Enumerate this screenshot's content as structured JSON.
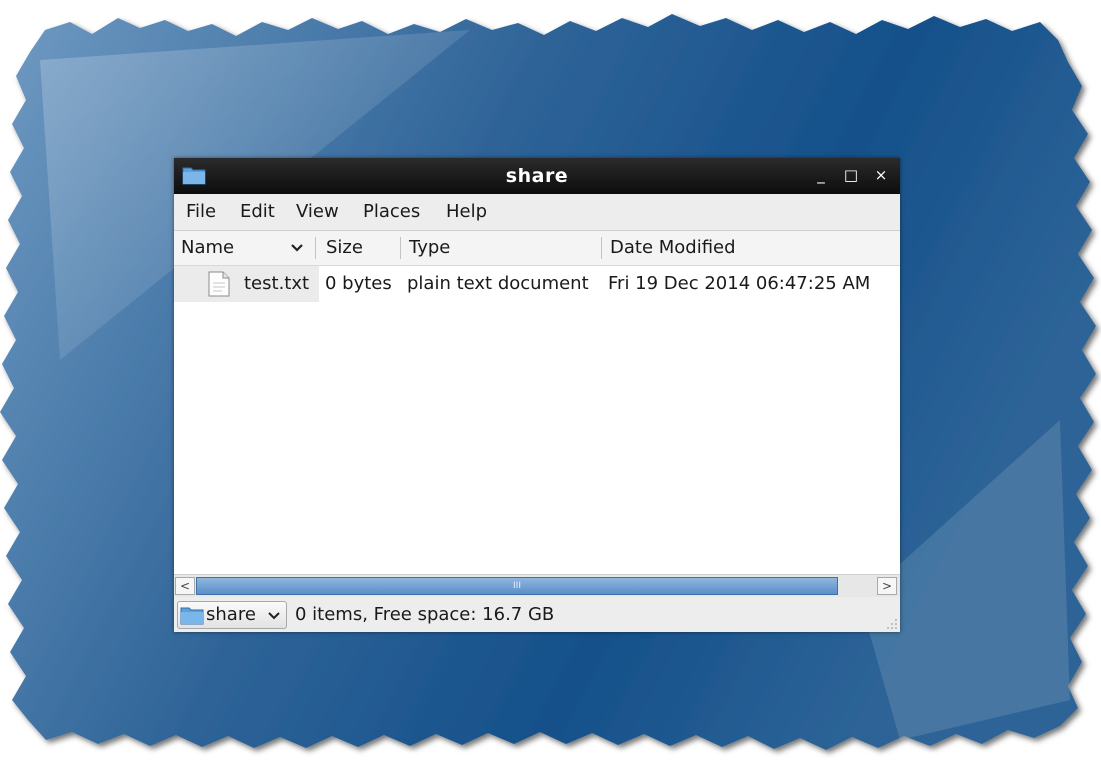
{
  "colors": {
    "desktop_dark": "#13467c",
    "desktop_light": "#7aa3c8",
    "titlebar": "#1a1a1a",
    "menubar": "#ededed",
    "selection": "#5a8fc8"
  },
  "window": {
    "title": "share",
    "icon": "folder-icon",
    "controls": {
      "minimize": "_",
      "maximize": "□",
      "close": "×"
    }
  },
  "menu": {
    "items": [
      "File",
      "Edit",
      "View",
      "Places",
      "Help"
    ]
  },
  "columns": {
    "name": "Name",
    "size": "Size",
    "type": "Type",
    "date": "Date Modified",
    "sort_indicator": "chevron-down-icon"
  },
  "files": [
    {
      "icon": "text-file-icon",
      "name": "test.txt",
      "size": "0 bytes",
      "type": "plain text document",
      "date_modified": "Fri 19 Dec 2014 06:47:25 AM"
    }
  ],
  "scrollbar": {
    "left_arrow": "<",
    "right_arrow": ">",
    "grip": "III"
  },
  "status": {
    "location": "share",
    "text": "0 items, Free space: 16.7 GB"
  }
}
